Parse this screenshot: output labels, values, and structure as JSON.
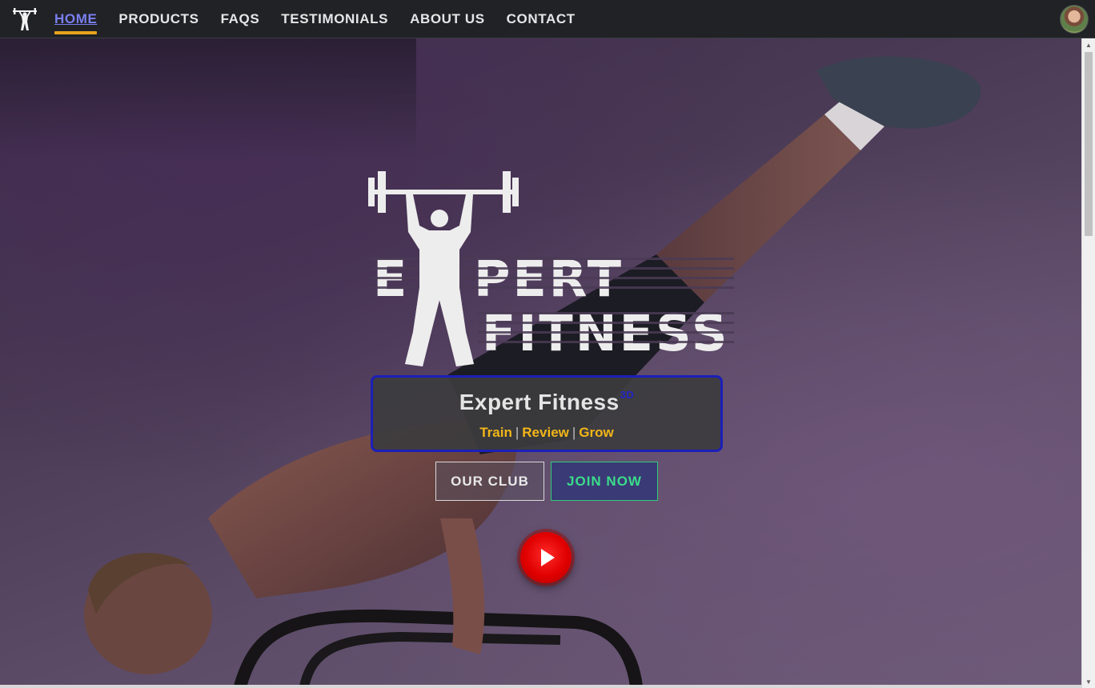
{
  "nav": {
    "logo_icon": "weightlifter-icon",
    "links": [
      {
        "label": "HOME",
        "active": true
      },
      {
        "label": "PRODUCTS",
        "active": false
      },
      {
        "label": "FAQS",
        "active": false
      },
      {
        "label": "TESTIMONIALS",
        "active": false
      },
      {
        "label": "ABOUT US",
        "active": false
      },
      {
        "label": "CONTACT",
        "active": false
      }
    ],
    "avatar_icon": "user-avatar"
  },
  "hero": {
    "logo": {
      "word1": "EXPERT",
      "word2": "FITNESS"
    },
    "title": "Expert Fitness",
    "title_sup": "3D",
    "tagline": {
      "words": [
        "Train",
        "Review",
        "Grow"
      ],
      "separator": "|"
    },
    "buttons": {
      "club": "OUR CLUB",
      "join": "JOIN NOW"
    },
    "play_icon": "play-icon"
  },
  "colors": {
    "nav_bg": "#202226",
    "active_link": "#7a7ff0",
    "active_underline": "#e7a51d",
    "tagline": "#f2b619",
    "title_border": "#1c1fb8",
    "join_button": "#3bdc8a",
    "play_button": "#e00000"
  }
}
